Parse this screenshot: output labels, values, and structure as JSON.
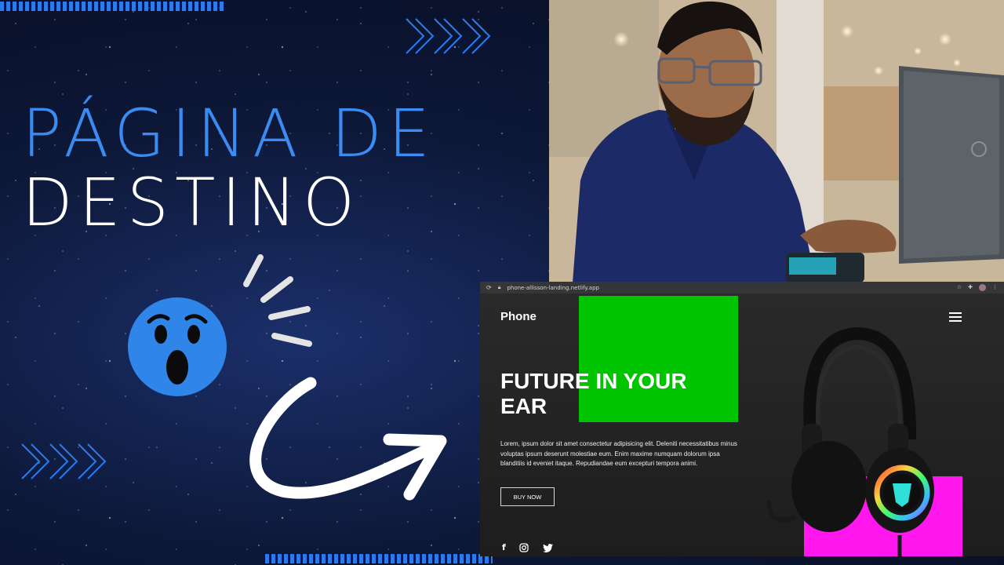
{
  "banner": {
    "title_line1": "PÁGINA DE",
    "title_line2": "DESTINO"
  },
  "colors": {
    "accent_blue": "#3a8bf2",
    "title_white": "#ffffff",
    "emoji_blue": "#2f86e8",
    "site_green": "#00c400",
    "site_magenta": "#ff17ee",
    "site_bg": "#232323"
  },
  "browser": {
    "url": "phone-allisson-landing.netlify.app"
  },
  "site": {
    "logo": "Phone",
    "hero_title": "FUTURE IN YOUR EAR",
    "hero_text": "Lorem, ipsum dolor sit amet consectetur adipisicing elit. Deleniti necessitatibus minus voluptas ipsum deserunt molestiae eum. Enim maxime numquam dolorum ipsa blanditiis id eveniet itaque. Repudiandae eum excepturi tempora animi.",
    "buy_button": "BUY NOW",
    "social": [
      "facebook-icon",
      "instagram-icon",
      "twitter-icon"
    ]
  },
  "icons": [
    "chevrons-right-icon",
    "surprised-face-icon",
    "curved-arrow-icon",
    "reload-icon",
    "lock-icon",
    "star-icon",
    "extensions-icon",
    "menu-dots-icon",
    "hamburger-menu-icon",
    "headset-icon"
  ]
}
